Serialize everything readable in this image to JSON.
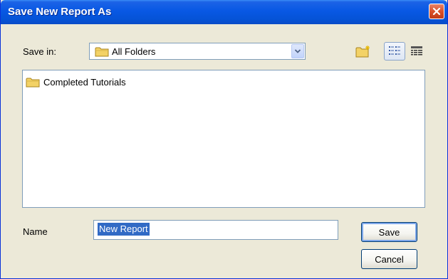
{
  "window": {
    "title": "Save New Report As"
  },
  "save_in": {
    "label": "Save in:",
    "selected": "All Folders",
    "icon": "folder-icon"
  },
  "toolbar": {
    "new_folder_icon": "new-folder-icon",
    "list_view_icon": "list-view-icon",
    "details_view_icon": "details-view-icon"
  },
  "file_list": {
    "items": [
      {
        "label": "Completed Tutorials",
        "icon": "folder-icon"
      }
    ]
  },
  "name_field": {
    "label": "Name",
    "value": "New Report"
  },
  "buttons": {
    "save": "Save",
    "cancel": "Cancel"
  },
  "colors": {
    "title_bar": "#0858e4",
    "dialog_bg": "#ece9d8",
    "close_button": "#d9512b",
    "selection": "#316ac5"
  }
}
